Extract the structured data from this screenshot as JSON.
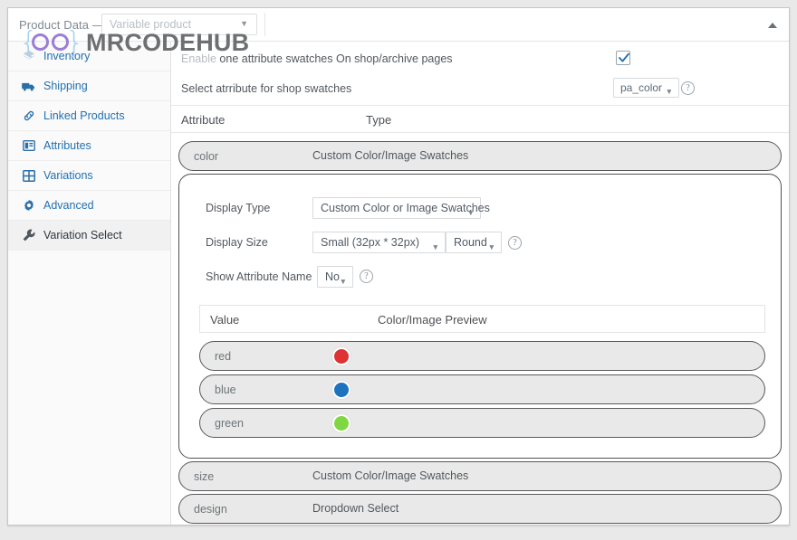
{
  "topbar": {
    "title": "Product Data —",
    "product_type_value": "Variable product",
    "collapse_icon": "caret-up-icon"
  },
  "watermark": {
    "brace_left": "{",
    "brace_right": "}",
    "text": "MRCODEHUB",
    "brace_color": "#a9d3ef",
    "ring_color": "#9b7ed6",
    "text_color": "#6d6f71"
  },
  "sidebar": {
    "items": [
      {
        "label": "Inventory",
        "icon": "inventory-icon",
        "active": false
      },
      {
        "label": "Shipping",
        "icon": "shipping-truck-icon",
        "active": false
      },
      {
        "label": "Linked Products",
        "icon": "link-icon",
        "active": false
      },
      {
        "label": "Attributes",
        "icon": "attributes-icon",
        "active": false
      },
      {
        "label": "Variations",
        "icon": "grid-icon",
        "active": false
      },
      {
        "label": "Advanced",
        "icon": "gear-icon",
        "active": false
      },
      {
        "label": "Variation Select",
        "icon": "wrench-icon",
        "active": true
      }
    ]
  },
  "main": {
    "enable_row": {
      "label_faded": "Enable",
      "label_rest": "one attribute swatches On shop/archive pages",
      "checkbox_checked": true
    },
    "select_attribute_row": {
      "label": "Select atrribute for shop swatches",
      "value": "pa_color",
      "help_icon": "question-mark-icon"
    },
    "attribute_table": {
      "col_attribute": "Attribute",
      "col_type": "Type"
    },
    "accordions": [
      {
        "name": "color",
        "type": "Custom Color/Image Swatches",
        "expanded": true
      },
      {
        "name": "size",
        "type": "Custom Color/Image Swatches",
        "expanded": false
      },
      {
        "name": "design",
        "type": "Dropdown Select",
        "expanded": false
      }
    ],
    "color_panel": {
      "display_type": {
        "label": "Display Type",
        "value": "Custom Color or Image Swatches"
      },
      "display_size": {
        "label": "Display Size",
        "value": "Small (32px * 32px)",
        "shape_value": "Round",
        "help_icon": "question-mark-icon"
      },
      "show_attribute_name": {
        "label": "Show Attribute Name",
        "value": "No",
        "help_icon": "question-mark-icon"
      },
      "value_table": {
        "col_value": "Value",
        "col_preview": "Color/Image Preview",
        "rows": [
          {
            "value": "red",
            "color": "#dd3333"
          },
          {
            "value": "blue",
            "color": "#1e73be"
          },
          {
            "value": "green",
            "color": "#81d742"
          }
        ]
      }
    }
  }
}
